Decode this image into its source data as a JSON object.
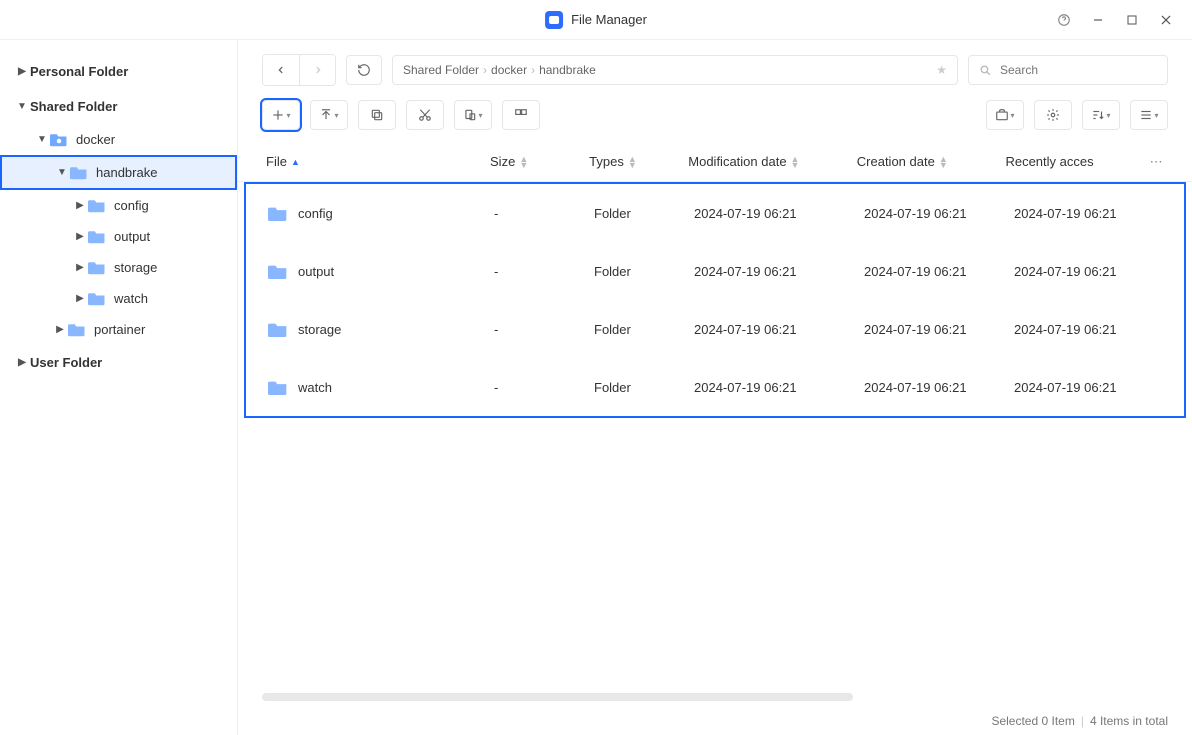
{
  "title": "File Manager",
  "sidebar": {
    "personal": "Personal Folder",
    "shared": "Shared Folder",
    "user": "User Folder",
    "docker": "docker",
    "handbrake": "handbrake",
    "config": "config",
    "output": "output",
    "storage": "storage",
    "watch": "watch",
    "portainer": "portainer"
  },
  "breadcrumb": [
    "Shared Folder",
    "docker",
    "handbrake"
  ],
  "search_placeholder": "Search",
  "columns": {
    "file": "File",
    "size": "Size",
    "types": "Types",
    "mod": "Modification date",
    "create": "Creation date",
    "acc": "Recently acces"
  },
  "rows": [
    {
      "name": "config",
      "size": "-",
      "type": "Folder",
      "mod": "2024-07-19 06:21",
      "create": "2024-07-19 06:21",
      "acc": "2024-07-19 06:21"
    },
    {
      "name": "output",
      "size": "-",
      "type": "Folder",
      "mod": "2024-07-19 06:21",
      "create": "2024-07-19 06:21",
      "acc": "2024-07-19 06:21"
    },
    {
      "name": "storage",
      "size": "-",
      "type": "Folder",
      "mod": "2024-07-19 06:21",
      "create": "2024-07-19 06:21",
      "acc": "2024-07-19 06:21"
    },
    {
      "name": "watch",
      "size": "-",
      "type": "Folder",
      "mod": "2024-07-19 06:21",
      "create": "2024-07-19 06:21",
      "acc": "2024-07-19 06:21"
    }
  ],
  "status": {
    "selected": "Selected 0 Item",
    "total": "4 Items in total"
  }
}
